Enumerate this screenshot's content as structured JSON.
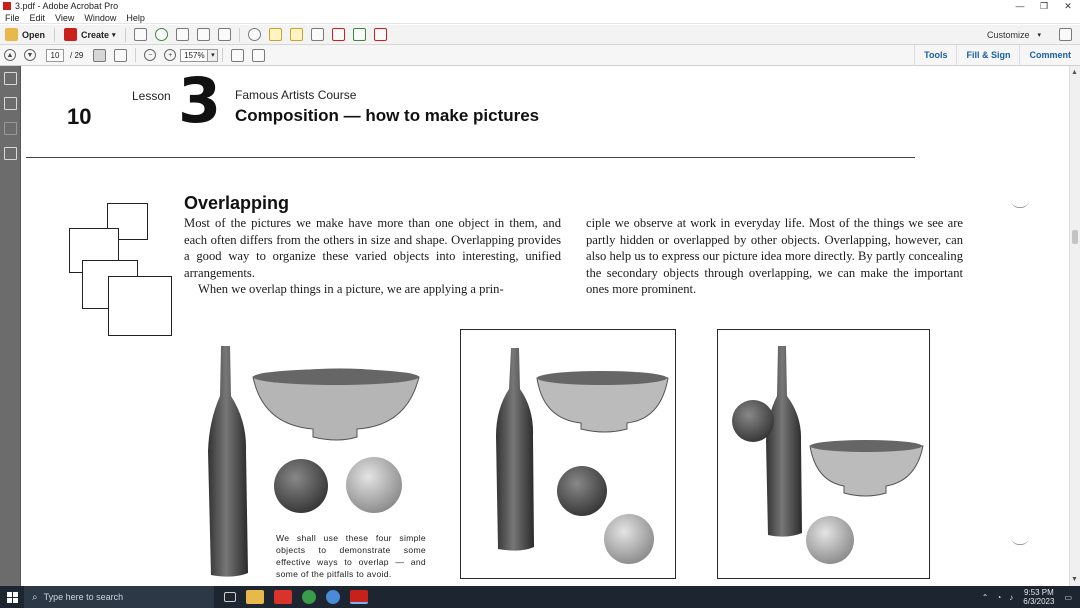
{
  "window": {
    "title": "3.pdf - Adobe Acrobat Pro",
    "controls": [
      "—",
      "❐",
      "✕"
    ]
  },
  "menu": [
    "File",
    "Edit",
    "View",
    "Window",
    "Help"
  ],
  "toolbar": {
    "open_label": "Open",
    "create_label": "Create",
    "customize_label": "Customize"
  },
  "nav": {
    "page_value": "10",
    "page_total": "/ 29",
    "zoom_value": "157%"
  },
  "right_links": [
    "Tools",
    "Fill & Sign",
    "Comment"
  ],
  "doc": {
    "page_number": "10",
    "lesson_label": "Lesson",
    "lesson_number": "3",
    "course": "Famous Artists Course",
    "title": "Composition — how to make pictures",
    "section_heading": "Overlapping",
    "para1": "Most of the pictures we make have more than one object in them, and each often differs from the others in size and shape. Overlapping provides a good way to organize these varied objects into interesting, unified arrangements.",
    "para2": "When we overlap things in a picture, we are applying a prin-",
    "para3": "ciple we observe at work in everyday life. Most of the things we see are partly hidden or overlapped by other objects. Overlapping, however, can also help us to express our picture idea more directly. By partly concealing the secondary objects through overlapping, we can make the important ones more prominent.",
    "caption": "We shall use these four simple objects to demonstrate some effective ways to overlap — and some of the pitfalls to avoid."
  },
  "taskbar": {
    "search_placeholder": "Type here to search",
    "time": "9:53 PM",
    "date": "6/3/2023"
  },
  "colors": {
    "accent_link": "#1a5fa3",
    "taskbar_bg": "#1c2530",
    "sidebar_bg": "#6c6c6c",
    "acrobat_red": "#c8201a"
  }
}
